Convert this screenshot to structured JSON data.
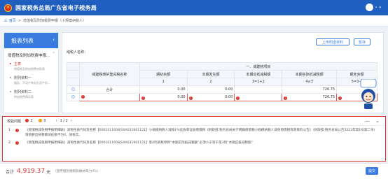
{
  "header": {
    "logo_glyph": "★",
    "title": "国家税务总局广东省电子税务局",
    "user_suffix": "•"
  },
  "breadcrumb": {
    "home": "首页",
    "separator": ">",
    "current": "增值税及附加税费申报（小规模纳税人）"
  },
  "sidebar": {
    "title": "报表列表",
    "group": "增值税及附加税费申报...",
    "items": [
      {
        "label": "主表",
        "desc": "增值税及附加税费申报表",
        "active": true
      },
      {
        "label": "附列资料一",
        "desc": "服务、不动产和无形资产扣..."
      },
      {
        "label": "附列资料二",
        "desc": "附加税费情况表"
      }
    ]
  },
  "toolbar": {
    "previous_label": "上传附送资料",
    "save_label": "暂存"
  },
  "taxpayer_label": "纳税人名称：",
  "table": {
    "section_title": "一、城建税项目",
    "row_header": "城建税维护建设税名称",
    "columns": [
      {
        "label": "期初余额",
        "num": "1"
      },
      {
        "label": "本期发生额",
        "num": "2"
      },
      {
        "label": "本期应抵减税额",
        "num": "3=1+2"
      },
      {
        "label": "本期实际抵减税额",
        "num": "4≤3"
      },
      {
        "label": "期末余额",
        "num": "5=3-4"
      }
    ],
    "rows": [
      {
        "name": "合计",
        "values": [
          "0.00",
          "0.00",
          "",
          "726.75",
          ""
        ]
      },
      {
        "name": "",
        "values": [
          "0.00",
          "0.00",
          "",
          "726.75",
          ""
        ]
      }
    ]
  },
  "validation": {
    "title": "校验问题",
    "error_count": "2",
    "warning_count": "0",
    "pager": "1 / 2",
    "items": [
      {
        "index": "1",
        "text": "《增值税减免税申报明细表》减免性质代码及名称【0001011608|SXA031901121】小规模纳税人减按1%征收率征收增值税《财政部 税务总局关于明确增值税小规模纳税人减免增值税等政策的公告》（财政部 税务总局公告2023年第1号第二条）增值税应纳税额减征额不为0，请核实。"
      },
      {
        "index": "2",
        "text": "《增值税减免税申报明细表》减免性质代码及名称【0001011608|SXA031901121】第4列减税项目“本期实际抵减税额”必须小于等于第3列“本期应抵减税额”"
      }
    ]
  },
  "footer": {
    "total_label": "合计",
    "amount": "4,919.37",
    "unit": "元",
    "note": "（随申报附缴税款缴纳率为0%）",
    "submit_label": "提交"
  },
  "colors": {
    "brand": "#1f5fbf",
    "accent": "#3a7be0",
    "error": "#d8322b",
    "warning": "#f0a020"
  }
}
